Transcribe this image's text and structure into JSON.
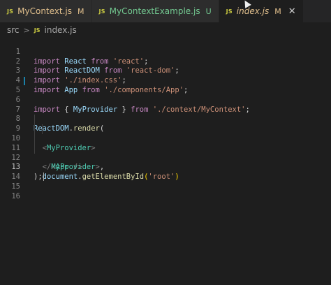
{
  "tabs": [
    {
      "icon": "JS",
      "name": "MyContext.js",
      "status": "M"
    },
    {
      "icon": "JS",
      "name": "MyContextExample.js",
      "status": "U"
    },
    {
      "icon": "JS",
      "name": "index.js",
      "status": "M",
      "close": "✕"
    }
  ],
  "breadcrumb": {
    "folder": "src",
    "sep": ">",
    "icon": "JS",
    "file": "index.js"
  },
  "editor": {
    "line_numbers": [
      "1",
      "2",
      "3",
      "4",
      "5",
      "6",
      "7",
      "8",
      "9",
      "10",
      "11",
      "12",
      "13",
      "14",
      "15",
      "16"
    ],
    "l1": {
      "a": "import",
      "b": "React",
      "c": "from",
      "d": "'react'",
      "e": ";"
    },
    "l2": {
      "a": "import",
      "b": "ReactDOM",
      "c": "from",
      "d": "'react-dom'",
      "e": ";"
    },
    "l3": {
      "a": "import",
      "d": "'./index.css'",
      "e": ";"
    },
    "l4": {
      "a": "import",
      "b": "App",
      "c": "from",
      "d": "'./components/App'",
      "e": ";"
    },
    "l5": {
      "a": "import",
      "b1": "{",
      "b": "MyProvider",
      "b2": "}",
      "c": "from",
      "d": "'./context/MyContext'",
      "e": ";"
    },
    "l8": {
      "a": "ReactDOM",
      "b": ".",
      "c": "render",
      "d": "("
    },
    "l9": {
      "lt": "<",
      "tag": "MyProvider",
      "gt": ">"
    },
    "l10": {
      "lt": "<",
      "tag": "App",
      "gt": " />"
    },
    "l11": {
      "lt": "</",
      "tag": "MyProvider",
      "gt": ">",
      "e": ","
    },
    "l12": {
      "a": "document",
      "b": ".",
      "c": "getElementById",
      "d": "(",
      "s": "'root'",
      "f": ")"
    },
    "l13": {
      "a": ");"
    }
  }
}
